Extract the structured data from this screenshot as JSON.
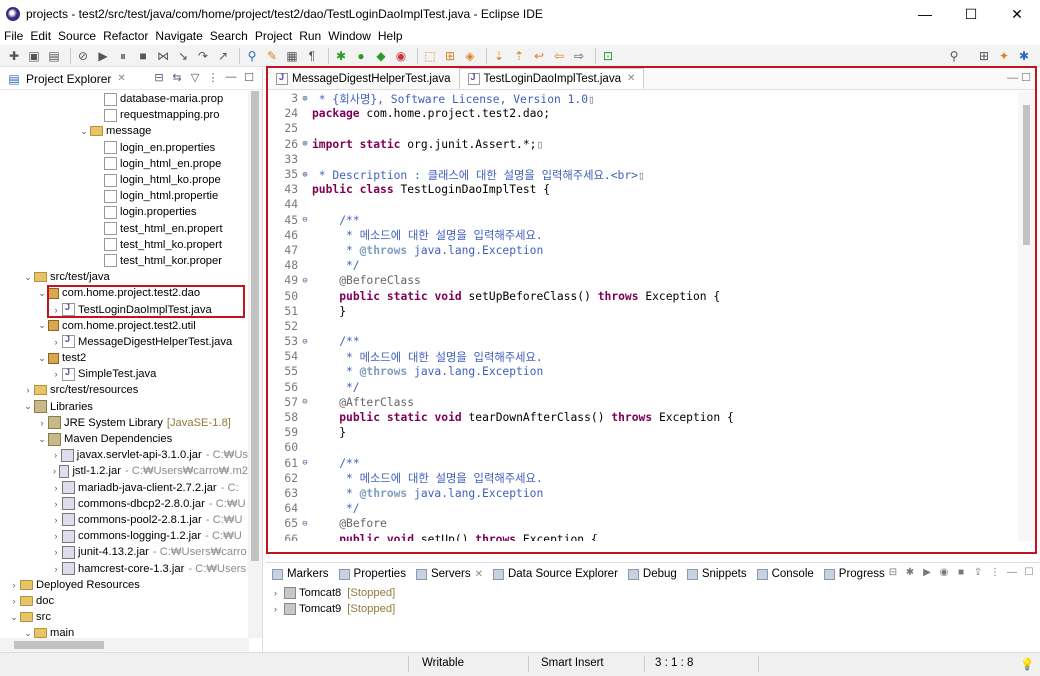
{
  "window": {
    "title": "projects - test2/src/test/java/com/home/project/test2/dao/TestLoginDaoImplTest.java - Eclipse IDE",
    "minimize": "—",
    "maximize": "☐",
    "close": "✕"
  },
  "menu": [
    "File",
    "Edit",
    "Source",
    "Refactor",
    "Navigate",
    "Search",
    "Project",
    "Run",
    "Window",
    "Help"
  ],
  "project_explorer": {
    "title": "Project Explorer",
    "tree": [
      {
        "label": "database-maria.prop",
        "indent": 7,
        "arrow": "",
        "icon": "file"
      },
      {
        "label": "requestmapping.pro",
        "indent": 7,
        "arrow": "",
        "icon": "file"
      },
      {
        "label": "message",
        "indent": 6,
        "arrow": "⌄",
        "icon": "folder"
      },
      {
        "label": "login_en.properties",
        "indent": 7,
        "arrow": "",
        "icon": "file"
      },
      {
        "label": "login_html_en.prope",
        "indent": 7,
        "arrow": "",
        "icon": "file"
      },
      {
        "label": "login_html_ko.prope",
        "indent": 7,
        "arrow": "",
        "icon": "file"
      },
      {
        "label": "login_html.propertie",
        "indent": 7,
        "arrow": "",
        "icon": "file"
      },
      {
        "label": "login.properties",
        "indent": 7,
        "arrow": "",
        "icon": "file"
      },
      {
        "label": "test_html_en.propert",
        "indent": 7,
        "arrow": "",
        "icon": "file"
      },
      {
        "label": "test_html_ko.propert",
        "indent": 7,
        "arrow": "",
        "icon": "file"
      },
      {
        "label": "test_html_kor.proper",
        "indent": 7,
        "arrow": "",
        "icon": "file"
      },
      {
        "label": "src/test/java",
        "indent": 2,
        "arrow": "⌄",
        "icon": "src"
      },
      {
        "label": "com.home.project.test2.dao",
        "indent": 3,
        "arrow": "⌄",
        "icon": "pkg"
      },
      {
        "label": "TestLoginDaoImplTest.java",
        "indent": 4,
        "arrow": "›",
        "icon": "java"
      },
      {
        "label": "com.home.project.test2.util",
        "indent": 3,
        "arrow": "⌄",
        "icon": "pkg"
      },
      {
        "label": "MessageDigestHelperTest.java",
        "indent": 4,
        "arrow": "›",
        "icon": "java"
      },
      {
        "label": "test2",
        "indent": 3,
        "arrow": "⌄",
        "icon": "pkg"
      },
      {
        "label": "SimpleTest.java",
        "indent": 4,
        "arrow": "›",
        "icon": "java"
      },
      {
        "label": "src/test/resources",
        "indent": 2,
        "arrow": "›",
        "icon": "src"
      },
      {
        "label": "Libraries",
        "indent": 2,
        "arrow": "⌄",
        "icon": "lib"
      },
      {
        "label": "JRE System Library",
        "extra": "[JavaSE-1.8]",
        "extraClass": "jre",
        "indent": 3,
        "arrow": "›",
        "icon": "lib"
      },
      {
        "label": "Maven Dependencies",
        "indent": 3,
        "arrow": "⌄",
        "icon": "lib"
      },
      {
        "label": "javax.servlet-api-3.1.0.jar",
        "extra": "- C:₩Us",
        "extraClass": "muted",
        "indent": 4,
        "arrow": "›",
        "icon": "jar"
      },
      {
        "label": "jstl-1.2.jar",
        "extra": "- C:₩Users₩carro₩.m2",
        "extraClass": "muted",
        "indent": 4,
        "arrow": "›",
        "icon": "jar"
      },
      {
        "label": "mariadb-java-client-2.7.2.jar",
        "extra": "- C:",
        "extraClass": "muted",
        "indent": 4,
        "arrow": "›",
        "icon": "jar"
      },
      {
        "label": "commons-dbcp2-2.8.0.jar",
        "extra": "- C:₩U",
        "extraClass": "muted",
        "indent": 4,
        "arrow": "›",
        "icon": "jar"
      },
      {
        "label": "commons-pool2-2.8.1.jar",
        "extra": "- C:₩U",
        "extraClass": "muted",
        "indent": 4,
        "arrow": "›",
        "icon": "jar"
      },
      {
        "label": "commons-logging-1.2.jar",
        "extra": "- C:₩U",
        "extraClass": "muted",
        "indent": 4,
        "arrow": "›",
        "icon": "jar"
      },
      {
        "label": "junit-4.13.2.jar",
        "extra": "- C:₩Users₩carro",
        "extraClass": "muted",
        "indent": 4,
        "arrow": "›",
        "icon": "jar"
      },
      {
        "label": "hamcrest-core-1.3.jar",
        "extra": "- C:₩Users",
        "extraClass": "muted",
        "indent": 4,
        "arrow": "›",
        "icon": "jar"
      },
      {
        "label": "Deployed Resources",
        "indent": 1,
        "arrow": "›",
        "icon": "folder"
      },
      {
        "label": "doc",
        "indent": 1,
        "arrow": "›",
        "icon": "folder"
      },
      {
        "label": "src",
        "indent": 1,
        "arrow": "⌄",
        "icon": "folder"
      },
      {
        "label": "main",
        "indent": 2,
        "arrow": "⌄",
        "icon": "folder"
      }
    ]
  },
  "editor": {
    "tabs": [
      {
        "label": "MessageDigestHelperTest.java",
        "active": false
      },
      {
        "label": "TestLoginDaoImplTest.java",
        "active": true
      }
    ],
    "lines": [
      {
        "n": "3",
        "fold": "⊕",
        "html": "<span class='cm'> * {회사명}, Software License, Version 1.0</span><span class='grey'>▯</span>"
      },
      {
        "n": "24",
        "fold": "",
        "html": "<span class='kw'>package</span> com.home.project.test2.dao;"
      },
      {
        "n": "25",
        "fold": "",
        "html": ""
      },
      {
        "n": "26",
        "fold": "⊕",
        "html": "<span class='kw'>import</span> <span class='kw'>static</span> org.junit.Assert.*;<span class='grey'>▯</span>"
      },
      {
        "n": "33",
        "fold": "",
        "html": ""
      },
      {
        "n": "35",
        "fold": "⊕",
        "html": "<span class='cm'> * Description : 클래스에 대한 설명을 입력해주세요.&lt;br&gt;</span><span class='grey'>▯</span>"
      },
      {
        "n": "43",
        "fold": "",
        "html": "<span class='kw'>public</span> <span class='kw'>class</span> TestLoginDaoImplTest {"
      },
      {
        "n": "44",
        "fold": "",
        "html": ""
      },
      {
        "n": "45",
        "fold": "⊖",
        "html": "    <span class='cm'>/**</span>"
      },
      {
        "n": "46",
        "fold": "",
        "html": "<span class='cm'>     * 메소드에 대한 설명을 입력해주세요.</span>"
      },
      {
        "n": "47",
        "fold": "",
        "html": "<span class='cm'>     * </span><span class='cmk'>@throws</span><span class='cm'> java.lang.Exception</span>"
      },
      {
        "n": "48",
        "fold": "",
        "html": "<span class='cm'>     */</span>"
      },
      {
        "n": "49",
        "fold": "⊖",
        "html": "    <span class='ann'>@BeforeClass</span>"
      },
      {
        "n": "50",
        "fold": "",
        "html": "    <span class='kw'>public</span> <span class='kw'>static</span> <span class='kw'>void</span> setUpBeforeClass() <span class='kw'>throws</span> Exception {"
      },
      {
        "n": "51",
        "fold": "",
        "html": "    }"
      },
      {
        "n": "52",
        "fold": "",
        "html": ""
      },
      {
        "n": "53",
        "fold": "⊖",
        "html": "    <span class='cm'>/**</span>"
      },
      {
        "n": "54",
        "fold": "",
        "html": "<span class='cm'>     * 메소드에 대한 설명을 입력해주세요.</span>"
      },
      {
        "n": "55",
        "fold": "",
        "html": "<span class='cm'>     * </span><span class='cmk'>@throws</span><span class='cm'> java.lang.Exception</span>"
      },
      {
        "n": "56",
        "fold": "",
        "html": "<span class='cm'>     */</span>"
      },
      {
        "n": "57",
        "fold": "⊖",
        "html": "    <span class='ann'>@AfterClass</span>"
      },
      {
        "n": "58",
        "fold": "",
        "html": "    <span class='kw'>public</span> <span class='kw'>static</span> <span class='kw'>void</span> tearDownAfterClass() <span class='kw'>throws</span> Exception {"
      },
      {
        "n": "59",
        "fold": "",
        "html": "    }"
      },
      {
        "n": "60",
        "fold": "",
        "html": ""
      },
      {
        "n": "61",
        "fold": "⊖",
        "html": "    <span class='cm'>/**</span>"
      },
      {
        "n": "62",
        "fold": "",
        "html": "<span class='cm'>     * 메소드에 대한 설명을 입력해주세요.</span>"
      },
      {
        "n": "63",
        "fold": "",
        "html": "<span class='cm'>     * </span><span class='cmk'>@throws</span><span class='cm'> java.lang.Exception</span>"
      },
      {
        "n": "64",
        "fold": "",
        "html": "<span class='cm'>     */</span>"
      },
      {
        "n": "65",
        "fold": "⊖",
        "html": "    <span class='ann'>@Before</span>"
      },
      {
        "n": "66",
        "fold": "",
        "html": "    <span class='kw'>public</span> <span class='kw'>void</span> setUp() <span class='kw'>throws</span> Exception {"
      }
    ]
  },
  "bottom_panel": {
    "tabs": [
      {
        "label": "Markers",
        "close": false
      },
      {
        "label": "Properties",
        "close": false
      },
      {
        "label": "Servers",
        "close": true
      },
      {
        "label": "Data Source Explorer",
        "close": false
      },
      {
        "label": "Debug",
        "close": false
      },
      {
        "label": "Snippets",
        "close": false
      },
      {
        "label": "Console",
        "close": false
      },
      {
        "label": "Progress",
        "close": false
      }
    ],
    "servers": [
      {
        "name": "Tomcat8",
        "state": "[Stopped]"
      },
      {
        "name": "Tomcat9",
        "state": "[Stopped]"
      }
    ]
  },
  "status": {
    "writable": "Writable",
    "insert_mode": "Smart Insert",
    "position": "3 : 1 : 8"
  }
}
